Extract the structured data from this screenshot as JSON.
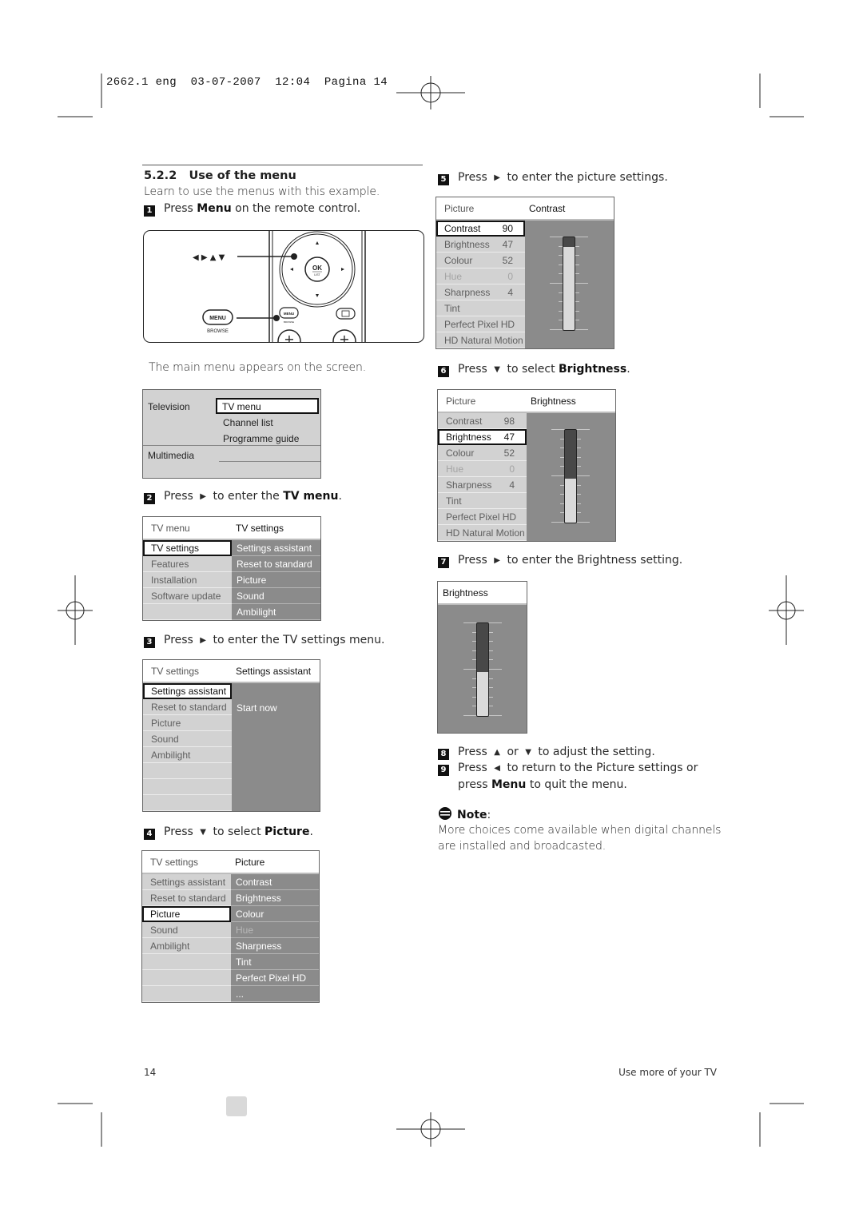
{
  "slug": "2662.1 eng  03-07-2007  12:04  Pagina 14",
  "section": {
    "number": "5.2.2",
    "title": "Use of the menu",
    "intro": "Learn to use the menus with this example."
  },
  "remote": {
    "arrows_label": "◀ ▶ ▲ ▼",
    "menu_label": "MENU",
    "browse_label": "BROWSE",
    "ok_label": "OK",
    "list_label": "LIST",
    "small_menu_label": "MENU",
    "small_browse_label": "BROWSE",
    "plus": "+"
  },
  "caption_main_menu": "The main menu appears on the screen.",
  "steps": [
    {
      "num": "1",
      "segments": [
        {
          "t": "Press "
        },
        {
          "t": "Menu",
          "s": "b"
        },
        {
          "t": " on the remote control."
        }
      ]
    },
    {
      "num": "2",
      "segments": [
        {
          "t": "Press "
        },
        {
          "t": "▶",
          "s": "arr"
        },
        {
          "t": " to enter the "
        },
        {
          "t": "TV menu",
          "s": "b"
        },
        {
          "t": "."
        }
      ]
    },
    {
      "num": "3",
      "segments": [
        {
          "t": "Press "
        },
        {
          "t": "▶",
          "s": "arr"
        },
        {
          "t": " to enter the TV settings menu."
        }
      ]
    },
    {
      "num": "4",
      "segments": [
        {
          "t": "Press "
        },
        {
          "t": "▼",
          "s": "arr"
        },
        {
          "t": " to select "
        },
        {
          "t": "Picture",
          "s": "b"
        },
        {
          "t": "."
        }
      ]
    },
    {
      "num": "5",
      "segments": [
        {
          "t": "Press "
        },
        {
          "t": "▶",
          "s": "arr"
        },
        {
          "t": " to enter the picture settings."
        }
      ]
    },
    {
      "num": "6",
      "segments": [
        {
          "t": "Press "
        },
        {
          "t": "▼",
          "s": "arr"
        },
        {
          "t": " to select "
        },
        {
          "t": "Brightness",
          "s": "b"
        },
        {
          "t": "."
        }
      ]
    },
    {
      "num": "7",
      "segments": [
        {
          "t": "Press "
        },
        {
          "t": "▶",
          "s": "arr"
        },
        {
          "t": " to enter the Brightness setting."
        }
      ]
    },
    {
      "num": "8",
      "segments": [
        {
          "t": "Press "
        },
        {
          "t": "▲",
          "s": "arr"
        },
        {
          "t": " or "
        },
        {
          "t": "▼",
          "s": "arr"
        },
        {
          "t": " to adjust the setting."
        }
      ]
    },
    {
      "num": "9",
      "segments": [
        {
          "t": "Press "
        },
        {
          "t": "◀",
          "s": "arr"
        },
        {
          "t": " to return to the Picture settings or"
        },
        {
          "t": "",
          "s": "br"
        },
        {
          "t": "press "
        },
        {
          "t": "Menu",
          "s": "b"
        },
        {
          "t": " to quit the menu."
        }
      ]
    }
  ],
  "main_menu": {
    "left": [
      "Television",
      "Multimedia"
    ],
    "items": [
      {
        "label": "TV menu",
        "selected": true
      },
      {
        "label": "Channel list"
      },
      {
        "label": "Programme guide"
      }
    ]
  },
  "menus": [
    {
      "id": "tv-menu",
      "header_left": "TV menu",
      "header_right": "TV settings",
      "right_mode": "list",
      "rows": [
        {
          "left": "TV settings",
          "selected": true,
          "right": "Settings assistant"
        },
        {
          "left": "Features",
          "right": "Reset to standard"
        },
        {
          "left": "Installation",
          "right": "Picture"
        },
        {
          "left": "Software update",
          "right": "Sound"
        },
        {
          "left": "",
          "right": "Ambilight"
        }
      ]
    },
    {
      "id": "tv-settings",
      "header_left": "TV settings",
      "header_right": "Settings assistant",
      "right_mode": "text",
      "right_text": "Start now",
      "rows": [
        {
          "left": "Settings assistant",
          "selected": true
        },
        {
          "left": "Reset to standard"
        },
        {
          "left": "Picture"
        },
        {
          "left": "Sound"
        },
        {
          "left": "Ambilight"
        },
        {
          "left": ""
        },
        {
          "left": ""
        },
        {
          "left": ""
        }
      ]
    },
    {
      "id": "tv-settings-picture",
      "header_left": "TV settings",
      "header_right": "Picture",
      "right_mode": "list",
      "rows": [
        {
          "left": "Settings assistant",
          "right": "Contrast"
        },
        {
          "left": "Reset to standard",
          "right": "Brightness"
        },
        {
          "left": "Picture",
          "selected": true,
          "right": "Colour"
        },
        {
          "left": "Sound",
          "right": "Hue",
          "right_faded": true
        },
        {
          "left": "Ambilight",
          "right": "Sharpness"
        },
        {
          "left": "",
          "right": "Tint"
        },
        {
          "left": "",
          "right": "Perfect Pixel HD"
        },
        {
          "left": "",
          "right": "..."
        }
      ]
    },
    {
      "id": "picture-contrast",
      "header_left": "Picture",
      "header_right": "Contrast",
      "right_mode": "slider",
      "slider_value": 90,
      "rows": [
        {
          "left": "Contrast",
          "value": "90",
          "selected": true
        },
        {
          "left": "Brightness",
          "value": "47"
        },
        {
          "left": "Colour",
          "value": "52"
        },
        {
          "left": "Hue",
          "value": "0",
          "faded": true
        },
        {
          "left": "Sharpness",
          "value": "4"
        },
        {
          "left": "Tint"
        },
        {
          "left": "Perfect Pixel HD"
        },
        {
          "left": "HD Natural Motion"
        }
      ]
    },
    {
      "id": "picture-brightness",
      "header_left": "Picture",
      "header_right": "Brightness",
      "right_mode": "slider",
      "slider_value": 47,
      "rows": [
        {
          "left": "Contrast",
          "value": "98"
        },
        {
          "left": "Brightness",
          "value": "47",
          "selected": true
        },
        {
          "left": "Colour",
          "value": "52"
        },
        {
          "left": "Hue",
          "value": "0",
          "faded": true
        },
        {
          "left": "Sharpness",
          "value": "4"
        },
        {
          "left": "Tint"
        },
        {
          "left": "Perfect Pixel HD"
        },
        {
          "left": "HD Natural Motion"
        }
      ]
    }
  ],
  "brightness_setting": {
    "title": "Brightness",
    "slider_value": 47
  },
  "note": {
    "title": "Note",
    "text_line1": "More choices come available when digital channels",
    "text_line2": "are installed and broadcasted."
  },
  "footer": {
    "page": "14",
    "section": "Use more of your TV"
  },
  "colors": {
    "menu_left": "#d2d2d2",
    "menu_right": "#8b8b8b",
    "selected": "#ffffff"
  }
}
